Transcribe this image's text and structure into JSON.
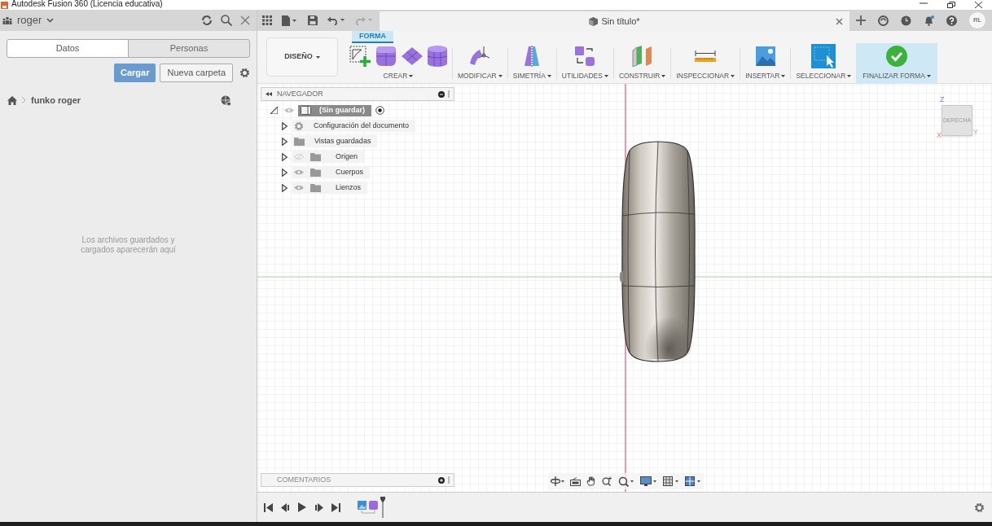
{
  "app_title": "Autodesk Fusion 360 (Licencia educativa)",
  "data_panel": {
    "project": "roger",
    "tabs": [
      {
        "label": "Datos",
        "selected": true
      },
      {
        "label": "Personas",
        "selected": false
      }
    ],
    "upload_button": "Cargar",
    "new_folder_button": "Nueva carpeta",
    "breadcrumb": "funko roger",
    "empty_message": "Los archivos guardados y cargados aparecerán aquí"
  },
  "document_tab": {
    "title": "Sin título*"
  },
  "user_initials": "RL",
  "workspace": "DISEÑO",
  "ribbon_tabs": [
    {
      "label": "FORMA",
      "selected": true
    }
  ],
  "tool_groups": [
    {
      "label": "CREAR",
      "highlighted": false
    },
    {
      "label": "MODIFICAR",
      "highlighted": false
    },
    {
      "label": "SIMETRÍA",
      "highlighted": false
    },
    {
      "label": "UTILIDADES",
      "highlighted": false
    },
    {
      "label": "CONSTRUIR",
      "highlighted": false
    },
    {
      "label": "INSPECCIONAR",
      "highlighted": false
    },
    {
      "label": "INSERTAR",
      "highlighted": false
    },
    {
      "label": "SELECCIONAR",
      "highlighted": false
    },
    {
      "label": "FINALIZAR FORMA",
      "highlighted": true
    }
  ],
  "browser": {
    "title": "NAVEGADOR",
    "root": "(Sin guardar)",
    "items": [
      {
        "label": "Configuración del documento",
        "kind": "settings"
      },
      {
        "label": "Vistas guardadas",
        "kind": "folder"
      },
      {
        "label": "Origen",
        "kind": "folder",
        "visible": false
      },
      {
        "label": "Cuerpos",
        "kind": "folder",
        "visible": true
      },
      {
        "label": "Lienzos",
        "kind": "folder",
        "visible": true
      }
    ]
  },
  "comments": {
    "title": "COMENTARIOS"
  },
  "view_cube": {
    "face": "DERECHA",
    "axes": [
      "Z",
      "X",
      "Y"
    ]
  }
}
